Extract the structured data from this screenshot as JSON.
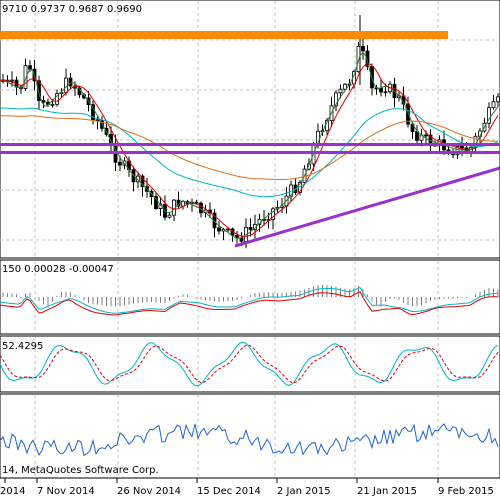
{
  "main_header": "9710 0.9737 0.9687 0.9690",
  "macd_header": "150 0.00028 -0.00047",
  "stoch_header": "52.4295",
  "copyright": "14, MetaQuotes Software Corp.",
  "x_labels": [
    "2014",
    "7 Nov 2014",
    "26 Nov 2014",
    "15 Dec 2014",
    "2 Jan 2015",
    "21 Jan 2015",
    "9 Feb 2015"
  ],
  "colors": {
    "background": "#ffffff",
    "grid": "#c0c0c0",
    "candle": "#000000",
    "resistance": "#ff8c00",
    "support_lines": "#9932cc",
    "ma_fast": "#2e7d32",
    "ma_red": "#e00000",
    "ma_cyan": "#00b7c3",
    "ma_orange": "#e0701a",
    "macd_signal": "#e00000",
    "macd_line": "#00b7c3",
    "stoch_main": "#00b7c3",
    "stoch_signal": "#e00000",
    "rsi": "#1e64d2"
  },
  "chart_data": {
    "type": "candlestick",
    "title": "",
    "xlabel": "",
    "ylabel": "",
    "grid": true,
    "x": [
      "2014",
      "7 Nov 2014",
      "26 Nov 2014",
      "15 Dec 2014",
      "2 Jan 2015",
      "21 Jan 2015",
      "9 Feb 2015"
    ],
    "ohlc_last": [
      0.971,
      0.9737,
      0.9687,
      0.969
    ],
    "macd": [
      0.00028,
      -0.00047
    ],
    "stochastic": 52.4295
  }
}
